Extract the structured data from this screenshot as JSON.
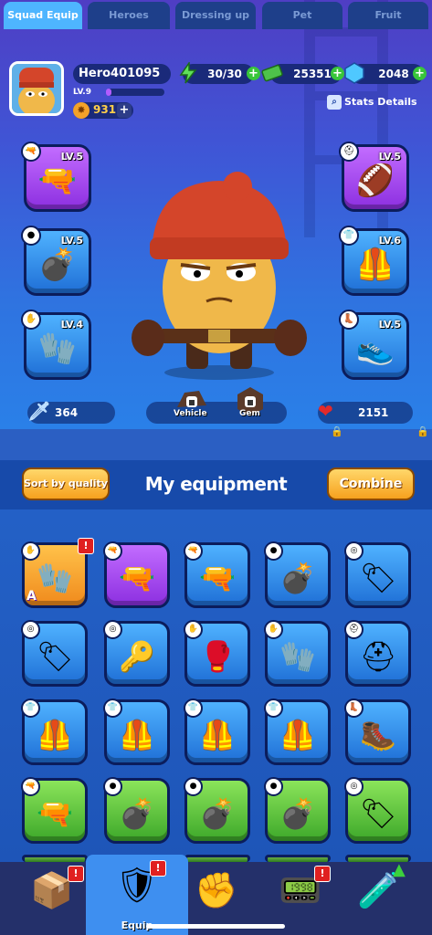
{
  "player": {
    "name": "Hero401095",
    "level": "LV.9",
    "xp_fraction": 0.1,
    "coins": "931"
  },
  "resources": {
    "energy": "30/30",
    "cash": "25351",
    "gems": "2048"
  },
  "stats_details_label": "Stats Details",
  "slots": [
    {
      "level": "LV.5",
      "rarity": "purple",
      "icon": "pistol-icon"
    },
    {
      "level": "LV.5",
      "rarity": "blue",
      "icon": "grenade-icon"
    },
    {
      "level": "LV.4",
      "rarity": "blue",
      "icon": "gloves-icon"
    },
    {
      "level": "LV.5",
      "rarity": "purple",
      "icon": "helmet-icon"
    },
    {
      "level": "LV.6",
      "rarity": "blue",
      "icon": "armor-icon"
    },
    {
      "level": "LV.5",
      "rarity": "blue",
      "icon": "boot-icon"
    }
  ],
  "attack": "364",
  "health": "2151",
  "vehicle_label": "Vehicle",
  "gem_label": "Gem",
  "tabs": [
    "Squad Equip",
    "Heroes",
    "Dressing up",
    "Pet",
    "Fruit"
  ],
  "sort_label": "Sort by quality",
  "panel_title": "My equipment",
  "combine_label": "Combine",
  "equipment": [
    {
      "rarity": "orange",
      "icon": "gloves-icon",
      "grade": "A",
      "alert": "!"
    },
    {
      "rarity": "purple",
      "icon": "pistol-icon"
    },
    {
      "rarity": "blue",
      "icon": "pistol-icon"
    },
    {
      "rarity": "blue",
      "icon": "grenade-icon"
    },
    {
      "rarity": "blue",
      "icon": "dogtag-icon"
    },
    {
      "rarity": "blue",
      "icon": "dogtag-icon"
    },
    {
      "rarity": "blue",
      "icon": "keychain-icon"
    },
    {
      "rarity": "blue",
      "icon": "glove-icon"
    },
    {
      "rarity": "blue",
      "icon": "gloves-icon"
    },
    {
      "rarity": "blue",
      "icon": "helmet-icon"
    },
    {
      "rarity": "blue",
      "icon": "armor-icon"
    },
    {
      "rarity": "blue",
      "icon": "armor-icon"
    },
    {
      "rarity": "blue",
      "icon": "armor-icon"
    },
    {
      "rarity": "blue",
      "icon": "vest-icon"
    },
    {
      "rarity": "blue",
      "icon": "boot-icon"
    },
    {
      "rarity": "green",
      "icon": "pistol-icon"
    },
    {
      "rarity": "green",
      "icon": "grenade-icon"
    },
    {
      "rarity": "green",
      "icon": "grenade-icon"
    },
    {
      "rarity": "green",
      "icon": "grenade-icon"
    },
    {
      "rarity": "green",
      "icon": "dogtag-icon"
    }
  ],
  "nav": [
    {
      "icon": "mystery-box-icon",
      "label": "",
      "alert": "!"
    },
    {
      "icon": "armor-icon",
      "label": "Equip",
      "alert": "!",
      "active": true
    },
    {
      "icon": "fist-icon",
      "label": ""
    },
    {
      "icon": "device-icon",
      "label": "",
      "alert": "!"
    },
    {
      "icon": "canister-icon",
      "label": "",
      "upgrade": true
    }
  ],
  "colors": {
    "purple": "#a24cf0",
    "blue": "#2f8ef0",
    "green": "#5fc83a",
    "orange": "#f7a52a",
    "accent": "#ffc84a"
  }
}
